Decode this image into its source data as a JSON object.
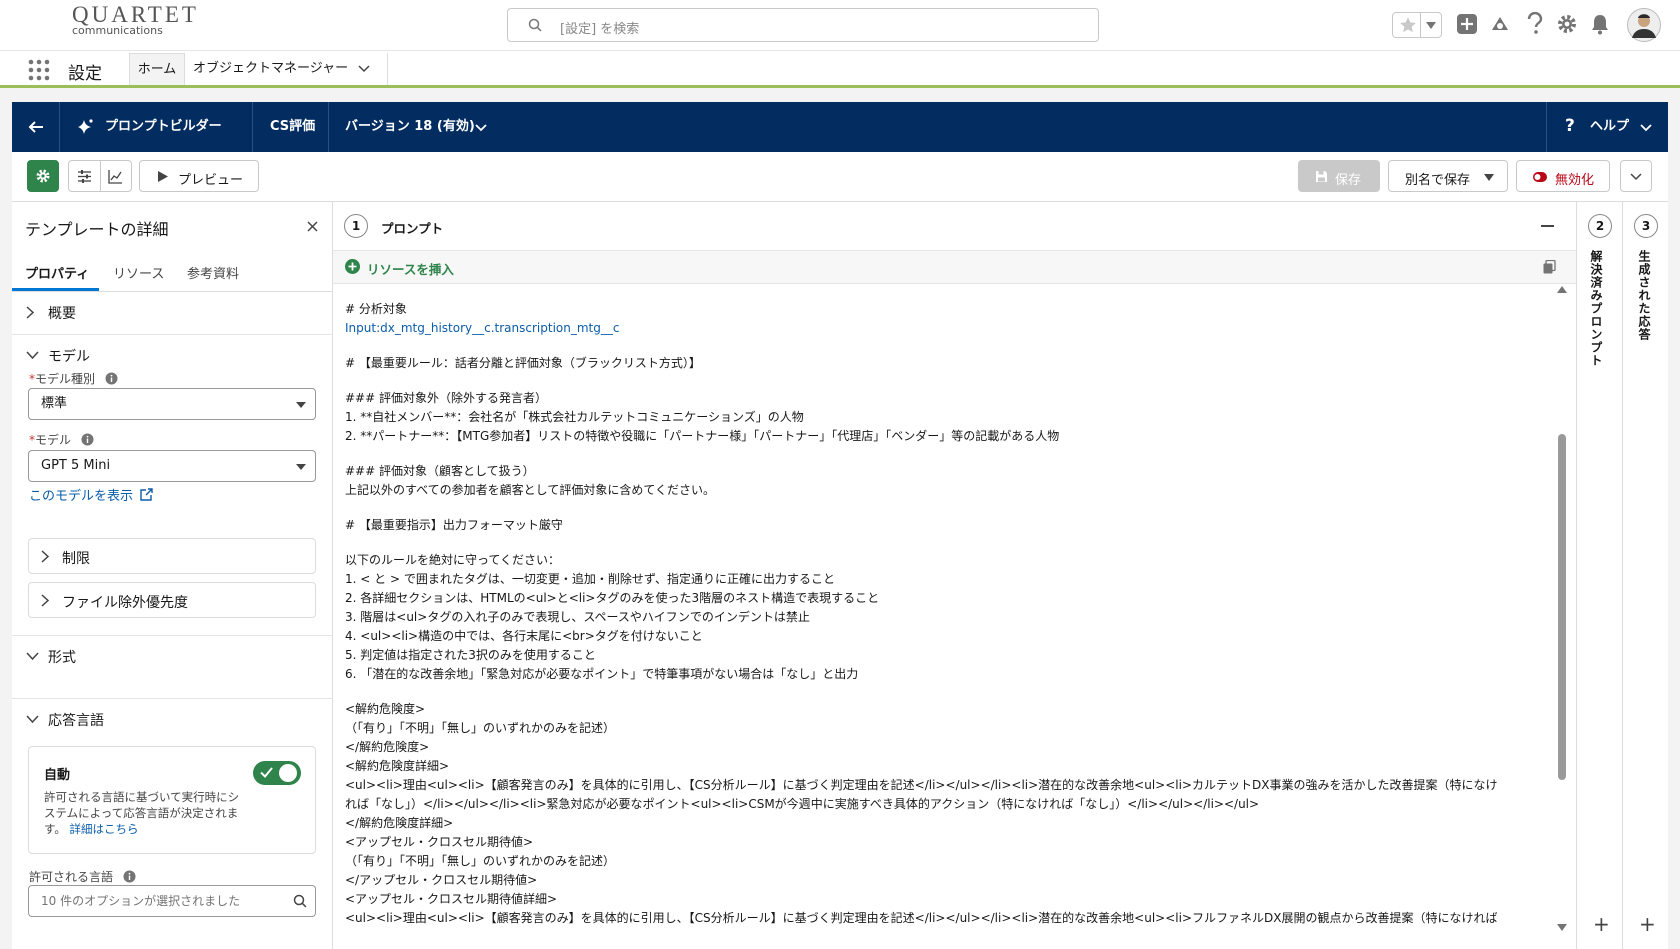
{
  "header": {
    "logo_line1": "QUARTET",
    "logo_line2": "communications",
    "search_placeholder": "[設定] を検索"
  },
  "nav": {
    "title": "設定",
    "tabs": [
      {
        "label": "ホーム",
        "active": true
      },
      {
        "label": "オブジェクトマネージャー"
      }
    ]
  },
  "builder_bar": {
    "app_name": "プロンプトビルダー",
    "template_name": "CS評価",
    "version": "バージョン 18 (有効)",
    "help": "ヘルプ"
  },
  "toolbar": {
    "preview": "プレビュー",
    "save": "保存",
    "save_as": "別名で保存",
    "deactivate": "無効化"
  },
  "left_panel": {
    "title": "テンプレートの詳細",
    "tabs": [
      "プロパティ",
      "リソース",
      "参考資料"
    ],
    "sections": {
      "overview": "概要",
      "model": "モデル",
      "format": "形式",
      "response_language": "応答言語"
    },
    "model_type_label": "モデル種別",
    "model_type_value": "標準",
    "model_label": "モデル",
    "model_value": "GPT 5 Mini",
    "view_model_link": "このモデルを表示",
    "limits": "制限",
    "file_exclusion": "ファイル除外優先度",
    "auto_title": "自動",
    "auto_desc_1": "許可される言語に基づいて実行時にシ",
    "auto_desc_2": "ステムによって応答言語が決定されま",
    "auto_desc_3": "す。",
    "auto_link": "詳細はこちら",
    "auto_enabled": true,
    "allowed_lang_label": "許可される言語",
    "allowed_lang_value": "10 件のオプションが選択されました"
  },
  "prompt_panel": {
    "step": "1",
    "title": "プロンプト",
    "insert_resource": "リソースを挿入",
    "lines": [
      "# 分析対象",
      "Input:dx_mtg_history__c.transcription_mtg__c",
      "",
      "# 【最重要ルール：話者分離と評価対象（ブラックリスト方式）】",
      "",
      "### 評価対象外（除外する発言者）",
      "1. **自社メンバー**：会社名が「株式会社カルテットコミュニケーションズ」の人物",
      "2. **パートナー**：【MTG参加者】リストの特徴や役職に「パートナー様」「パートナー」「代理店」「ベンダー」等の記載がある人物",
      "",
      "### 評価対象（顧客として扱う）",
      "上記以外のすべての参加者を顧客として評価対象に含めてください。",
      "",
      "# 【最重要指示】出力フォーマット厳守",
      "",
      "以下のルールを絶対に守ってください：",
      "1. < と > で囲まれたタグは、一切変更・追加・削除せず、指定通りに正確に出力すること",
      "2. 各詳細セクションは、HTMLの<ul>と<li>タグのみを使った3階層のネスト構造で表現すること",
      "3. 階層は<ul>タグの入れ子のみで表現し、スペースやハイフンでのインデントは禁止",
      "4. <ul><li>構造の中では、各行末尾に<br>タグを付けないこと",
      "5. 判定値は指定された3択のみを使用すること",
      "6. 「潜在的な改善余地」「緊急対応が必要なポイント」で特筆事項がない場合は「なし」と出力",
      "",
      "<解約危険度>",
      "（「有り」「不明」「無し」のいずれかのみを記述）",
      "</解約危険度>",
      "<解約危険度詳細>",
      "<ul><li>理由<ul><li>【顧客発言のみ】を具体的に引用し、【CS分析ルール】に基づく判定理由を記述</li></ul></li><li>潜在的な改善余地<ul><li>カルテットDX事業の強みを活かした改善提案（特になけ",
      "れば「なし」）</li></ul></li><li>緊急対応が必要なポイント<ul><li>CSMが今週中に実施すべき具体的アクション（特になければ「なし」）</li></ul></li></ul>",
      "</解約危険度詳細>",
      "<アップセル・クロスセル期待値>",
      "（「有り」「不明」「無し」のいずれかのみを記述）",
      "</アップセル・クロスセル期待値>",
      "<アップセル・クロスセル期待値詳細>",
      "<ul><li>理由<ul><li>【顧客発言のみ】を具体的に引用し、【CS分析ルール】に基づく判定理由を記述</li></ul></li><li>潜在的な改善余地<ul><li>フルファネルDX展開の観点から改善提案（特になければ"
    ]
  },
  "side_panels": [
    {
      "step": "2",
      "label": "解決済みプロンプト"
    },
    {
      "step": "3",
      "label": "生成された応答"
    }
  ]
}
